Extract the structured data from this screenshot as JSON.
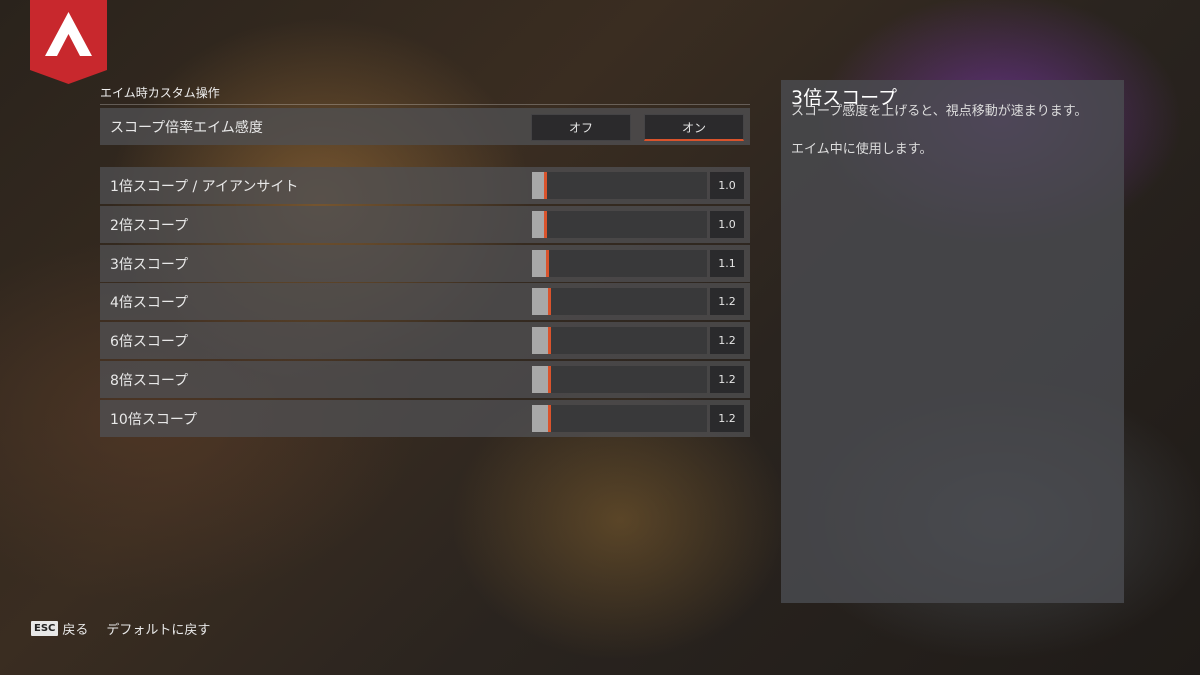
{
  "section_title": "エイム時カスタム操作",
  "toggle_row": {
    "label": "スコープ倍率エイム感度",
    "off_label": "オフ",
    "on_label": "オン",
    "selected": "オン"
  },
  "sliders": [
    {
      "label": "1倍スコープ / アイアンサイト",
      "value": "1.0",
      "fill_fraction": 0.07
    },
    {
      "label": "2倍スコープ",
      "value": "1.0",
      "fill_fraction": 0.07
    },
    {
      "label": "3倍スコープ",
      "value": "1.1",
      "fill_fraction": 0.08
    },
    {
      "label": "4倍スコープ",
      "value": "1.2",
      "fill_fraction": 0.09
    },
    {
      "label": "6倍スコープ",
      "value": "1.2",
      "fill_fraction": 0.09
    },
    {
      "label": "8倍スコープ",
      "value": "1.2",
      "fill_fraction": 0.09
    },
    {
      "label": "10倍スコープ",
      "value": "1.2",
      "fill_fraction": 0.09
    }
  ],
  "info": {
    "title": "3倍スコープ",
    "body_1": "スコープ感度を上げると、視点移動が速まります。",
    "body_2": "エイム中に使用します。"
  },
  "footer": {
    "esc_key": "ESC",
    "back_label": "戻る",
    "reset_label": "デフォルトに戻す"
  },
  "colors": {
    "accent": "#d9532c",
    "logo_red": "#c8282d"
  },
  "icons": {
    "logo": "apex-legends-logo"
  }
}
